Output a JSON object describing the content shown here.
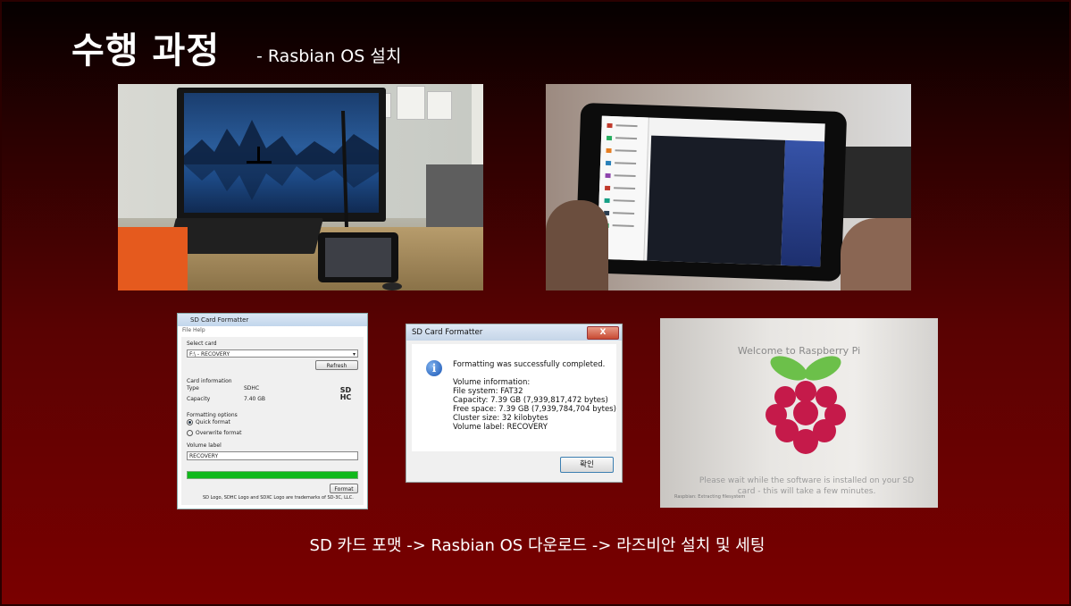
{
  "slide": {
    "title": "수행 과정",
    "subtitle": "- Rasbian OS 설치",
    "caption": "SD 카드 포맷 -> Rasbian OS  다운로드 -> 라즈비안 설치 및 세팅"
  },
  "sd_formatter": {
    "window_title": "SD Card Formatter",
    "menu": "File  Help",
    "select_card_label": "Select card",
    "selected_card": "F:\\ - RECOVERY",
    "refresh_label": "Refresh",
    "card_info_label": "Card information",
    "type_label": "Type",
    "type_value": "SDHC",
    "capacity_label": "Capacity",
    "capacity_value": "7.40 GB",
    "sdhc_logo": "SD HC",
    "formatting_options_label": "Formatting options",
    "quick_format_label": "Quick format",
    "overwrite_format_label": "Overwrite format",
    "volume_label_label": "Volume label",
    "volume_label_value": "RECOVERY",
    "progress": 1.0,
    "format_button": "Format",
    "footer": "SD Logo, SDHC Logo and SDXC Logo are trademarks of SD-3C, LLC."
  },
  "completed_dialog": {
    "title": "SD Card Formatter",
    "close": "X",
    "message": "Formatting was successfully completed.",
    "volume_info": "Volume information:",
    "file_system": "File system: FAT32",
    "capacity": "Capacity: 7.39 GB (7,939,817,472 bytes)",
    "free_space": "Free space: 7.39 GB (7,939,784,704 bytes)",
    "cluster_size": "Cluster size: 32 kilobytes",
    "volume_label": "Volume label: RECOVERY",
    "ok_button": "확인"
  },
  "raspberry_screen": {
    "welcome": "Welcome to Raspberry Pi",
    "please_wait_1": "Please wait while the software is installed on your SD",
    "please_wait_2": "card - this will take a few minutes.",
    "status": "Raspbian: Extracting filesystem"
  },
  "colors": {
    "accent_red": "#7a0000",
    "progress_green": "#10b91b",
    "raspberry": "#c51a4a",
    "leaf": "#6cc04a"
  }
}
